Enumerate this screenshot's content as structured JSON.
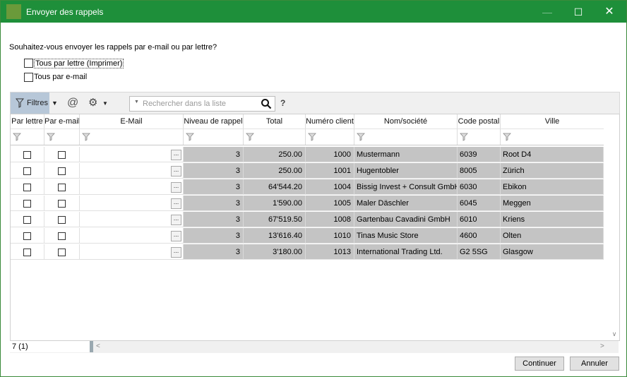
{
  "window": {
    "title": "Envoyer des rappels",
    "minimize_glyph": "—",
    "maximize_glyph": "☐",
    "close_glyph": "✕"
  },
  "question": "Souhaitez-vous envoyer les rappels par e-mail ou par lettre?",
  "options": [
    {
      "label": "Tous par lettre (Imprimer)",
      "checked": false
    },
    {
      "label": "Tous par e-mail",
      "checked": false
    }
  ],
  "toolbar": {
    "filter_label": "Filtres",
    "at_glyph": "@",
    "gear_glyph": "⚙",
    "search_placeholder": "Rechercher dans la liste",
    "help_glyph": "?"
  },
  "columns": [
    "Par lettre",
    "Par e-mail",
    "E-Mail",
    "Niveau de rappel",
    "Total",
    "Numéro client",
    "Nom/société",
    "Code postal",
    "Ville"
  ],
  "rows": [
    {
      "par_lettre": false,
      "par_email": false,
      "email": "",
      "niveau": "3",
      "total": "250.00",
      "client": "1000",
      "nom": "Mustermann",
      "cp": "6039",
      "ville": "Root D4"
    },
    {
      "par_lettre": false,
      "par_email": false,
      "email": "",
      "niveau": "3",
      "total": "250.00",
      "client": "1001",
      "nom": "Hugentobler",
      "cp": "8005",
      "ville": "Zürich"
    },
    {
      "par_lettre": false,
      "par_email": false,
      "email": "",
      "niveau": "3",
      "total": "64'544.20",
      "client": "1004",
      "nom": "Bissig Invest + Consult GmbH",
      "cp": "6030",
      "ville": "Ebikon"
    },
    {
      "par_lettre": false,
      "par_email": false,
      "email": "",
      "niveau": "3",
      "total": "1'590.00",
      "client": "1005",
      "nom": "Maler Däschler",
      "cp": "6045",
      "ville": "Meggen"
    },
    {
      "par_lettre": false,
      "par_email": false,
      "email": "",
      "niveau": "3",
      "total": "67'519.50",
      "client": "1008",
      "nom": "Gartenbau Cavadini GmbH",
      "cp": "6010",
      "ville": "Kriens"
    },
    {
      "par_lettre": false,
      "par_email": false,
      "email": "",
      "niveau": "3",
      "total": "13'616.40",
      "client": "1010",
      "nom": "Tinas Music Store",
      "cp": "4600",
      "ville": "Olten"
    },
    {
      "par_lettre": false,
      "par_email": false,
      "email": "",
      "niveau": "3",
      "total": "3'180.00",
      "client": "1013",
      "nom": "International Trading Ltd.",
      "cp": "G2 5SG",
      "ville": "Glasgow"
    }
  ],
  "ellipsis": "...",
  "status": {
    "count": "7 (1)"
  },
  "buttons": {
    "continue": "Continuer",
    "cancel": "Annuler"
  },
  "colors": {
    "titlebar": "#1e8f3a",
    "readonly_cell": "#c4c4c4",
    "filter_button": "#b7c7d8"
  }
}
